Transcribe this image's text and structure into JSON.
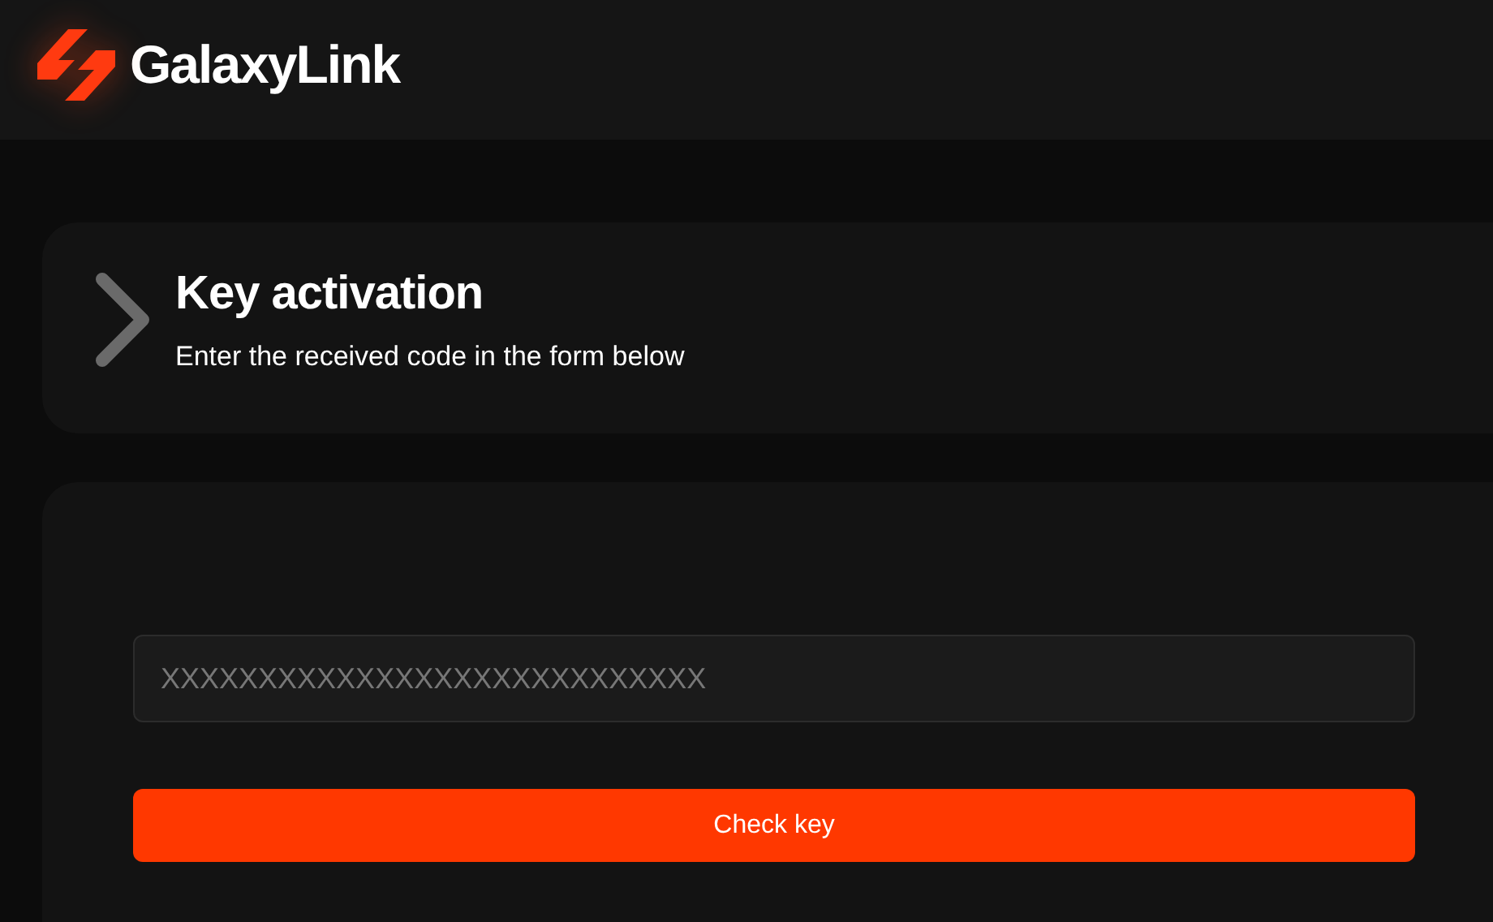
{
  "header": {
    "brand": "GalaxyLink"
  },
  "intro": {
    "title": "Key activation",
    "subtitle": "Enter the received code in the form below"
  },
  "form": {
    "key_field": {
      "placeholder": "XXXXXXXXXXXXXXXXXXXXXXXXXXXX"
    },
    "submit": "Check key"
  }
}
